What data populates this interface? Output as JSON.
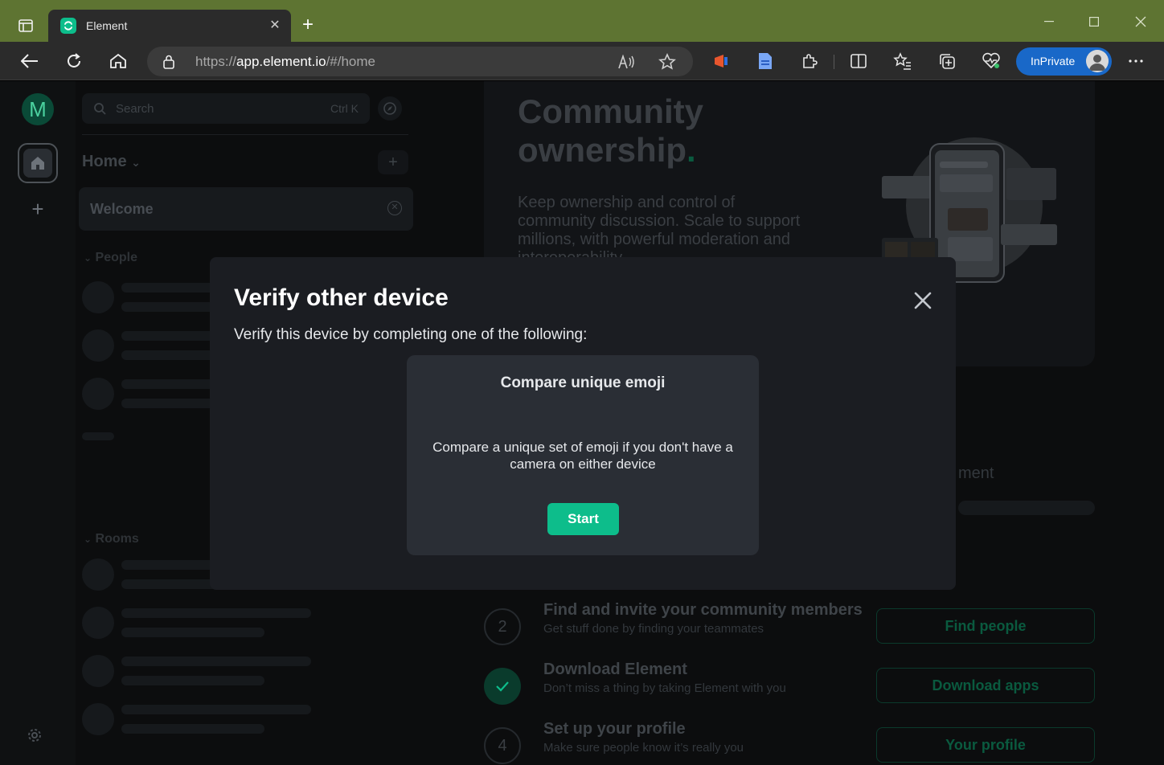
{
  "browser": {
    "tab_title": "Element",
    "url_prefix": "https://",
    "url_host": "app.element.io",
    "url_path": "/#/home",
    "inprivate_label": "InPrivate",
    "accent": "#5e7432"
  },
  "spaces": {
    "user_initial": "M"
  },
  "roomlist": {
    "search_placeholder": "Search",
    "search_shortcut": "Ctrl K",
    "home_label": "Home",
    "welcome_room": "Welcome",
    "people_section": "People",
    "rooms_section": "Rooms"
  },
  "home": {
    "hero_title": "Community ownership",
    "hero_title_dot": ".",
    "hero_text": "Keep ownership and control of community discussion. Scale to support millions, with powerful moderation and interoperability.",
    "partial_text": "ment",
    "tasks": [
      {
        "number": "2",
        "title": "Find and invite your community members",
        "subtitle": "Get stuff done by finding your teammates",
        "button": "Find people"
      },
      {
        "number": "",
        "title": "Download Element",
        "subtitle": "Don’t miss a thing by taking Element with you",
        "button": "Download apps"
      },
      {
        "number": "4",
        "title": "Set up your profile",
        "subtitle": "Make sure people know it’s really you",
        "button": "Your profile"
      }
    ]
  },
  "dialog": {
    "title": "Verify other device",
    "subtitle": "Verify this device by completing one of the following:",
    "card_title": "Compare unique emoji",
    "card_description": "Compare a unique set of emoji if you don't have a camera on either device",
    "start_label": "Start",
    "accent": "#0dbd8b"
  }
}
